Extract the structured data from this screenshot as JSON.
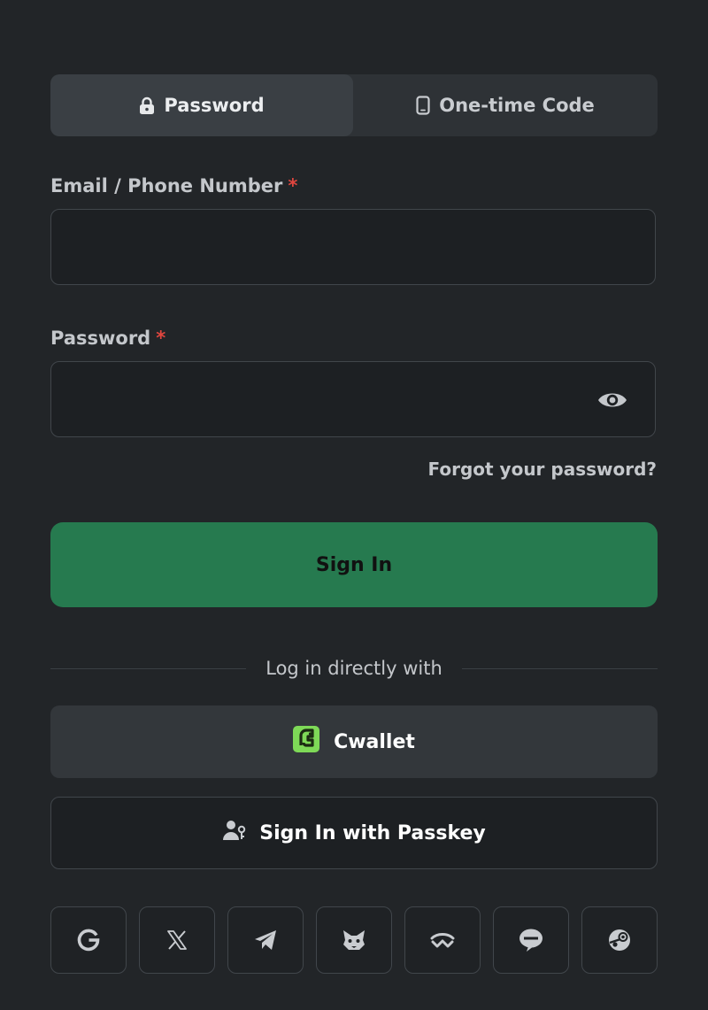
{
  "tabs": [
    {
      "label": "Password",
      "icon": "lock-icon",
      "active": true
    },
    {
      "label": "One-time Code",
      "icon": "phone-icon",
      "active": false
    }
  ],
  "email_field": {
    "label": "Email / Phone Number",
    "required_mark": "*",
    "value": ""
  },
  "password_field": {
    "label": "Password",
    "required_mark": "*",
    "value": ""
  },
  "forgot_link": "Forgot your password?",
  "sign_in_button": "Sign In",
  "divider_text": "Log in directly with",
  "cwallet_button": "Cwallet",
  "passkey_button": "Sign In with Passkey",
  "social_logins": [
    {
      "icon": "google-icon"
    },
    {
      "icon": "x-icon"
    },
    {
      "icon": "telegram-icon"
    },
    {
      "icon": "metamask-icon"
    },
    {
      "icon": "walletconnect-icon"
    },
    {
      "icon": "line-icon"
    },
    {
      "icon": "steam-icon"
    }
  ],
  "colors": {
    "background": "#222528",
    "primary": "#267a4f",
    "required": "#e0463f",
    "cwallet_accent": "#7ed957"
  }
}
